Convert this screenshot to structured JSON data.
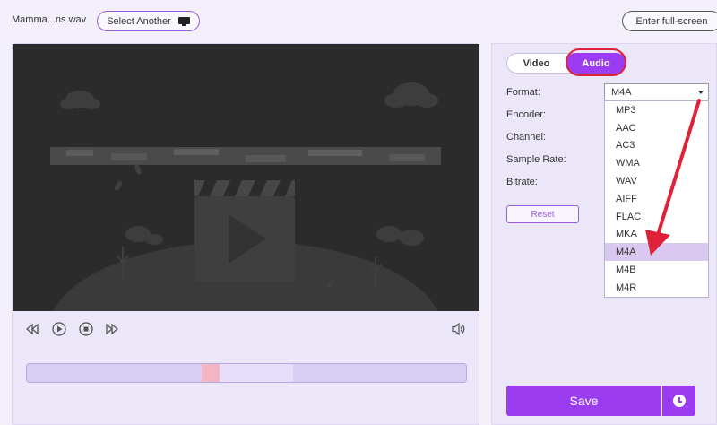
{
  "topbar": {
    "filename": "Mamma...ns.wav",
    "select_another_label": "Select Another",
    "fullscreen_label": "Enter full-screen"
  },
  "settings": {
    "tabs": [
      {
        "label": "Video",
        "active": false
      },
      {
        "label": "Audio",
        "active": true
      }
    ],
    "labels": {
      "format": "Format:",
      "encoder": "Encoder:",
      "channel": "Channel:",
      "sample_rate": "Sample Rate:",
      "bitrate": "Bitrate:"
    },
    "format_value": "M4A",
    "format_options": [
      "MP3",
      "AAC",
      "AC3",
      "WMA",
      "WAV",
      "AIFF",
      "FLAC",
      "MKA",
      "M4A",
      "M4B",
      "M4R"
    ],
    "selected_option": "M4A",
    "reset_label": "Reset",
    "save_label": "Save"
  },
  "colors": {
    "accent": "#9b3cf0",
    "highlight_ring": "#e0213a",
    "video_bg": "#2b2b2b"
  },
  "icons": [
    "monitor-icon",
    "previous-frame-icon",
    "play-icon",
    "stop-icon",
    "next-frame-icon",
    "volume-icon",
    "clock-icon",
    "chevron-down-icon"
  ]
}
